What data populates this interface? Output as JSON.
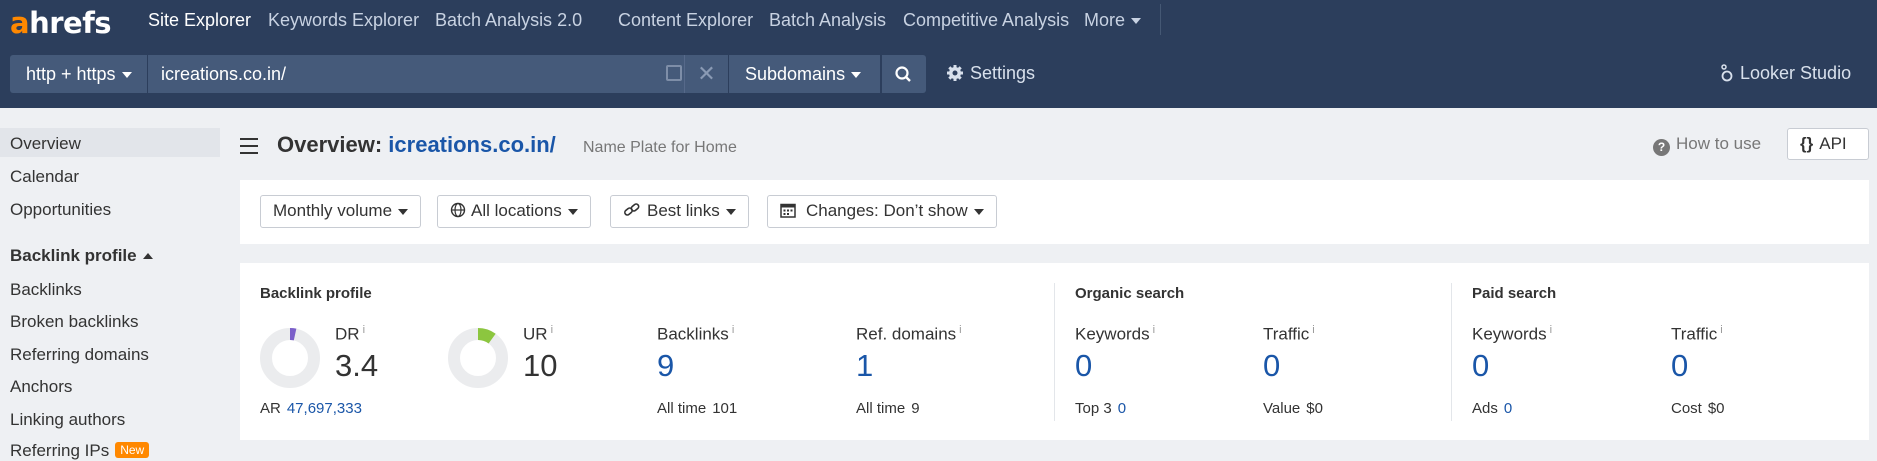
{
  "nav": {
    "logo_a": "a",
    "logo_rest": "hrefs",
    "items": [
      "Site Explorer",
      "Keywords Explorer",
      "Batch Analysis 2.0",
      "Content Explorer",
      "Batch Analysis",
      "Competitive Analysis",
      "More"
    ]
  },
  "search": {
    "protocol": "http + https",
    "url": "icreations.co.in/",
    "mode": "Subdomains",
    "settings_label": "Settings",
    "looker_label": "Looker Studio"
  },
  "sidebar": {
    "items": [
      "Overview",
      "Calendar",
      "Opportunities"
    ],
    "section": "Backlink profile",
    "sub_items": [
      "Backlinks",
      "Broken backlinks",
      "Referring domains",
      "Anchors",
      "Linking authors",
      "Referring IPs"
    ],
    "new_badge": "New"
  },
  "header": {
    "title_prefix": "Overview:",
    "title_link": "icreations.co.in/",
    "subtitle": "Name Plate for Home",
    "how_to": "How to use",
    "api": "API"
  },
  "filters": [
    "Monthly volume",
    "All locations",
    "Best links",
    "Changes: Don’t show"
  ],
  "metrics": {
    "backlink_profile": {
      "heading": "Backlink profile",
      "dr_label": "DR",
      "dr_value": "3.4",
      "dr_fraction": 0.034,
      "ar_label": "AR",
      "ar_value": "47,697,333",
      "ur_label": "UR",
      "ur_value": "10",
      "ur_fraction": 0.1,
      "backlinks_label": "Backlinks",
      "backlinks_value": "9",
      "backlinks_sub_label": "All time",
      "backlinks_sub_value": "101",
      "refdomains_label": "Ref. domains",
      "refdomains_value": "1",
      "refdomains_sub_label": "All time",
      "refdomains_sub_value": "9"
    },
    "organic": {
      "heading": "Organic search",
      "keywords_label": "Keywords",
      "keywords_value": "0",
      "keywords_sub_label": "Top 3",
      "keywords_sub_value": "0",
      "traffic_label": "Traffic",
      "traffic_value": "0",
      "traffic_sub_label": "Value",
      "traffic_sub_value": "$0"
    },
    "paid": {
      "heading": "Paid search",
      "keywords_label": "Keywords",
      "keywords_value": "0",
      "keywords_sub_label": "Ads",
      "keywords_sub_value": "0",
      "traffic_label": "Traffic",
      "traffic_value": "0",
      "traffic_sub_label": "Cost",
      "traffic_sub_value": "$0"
    },
    "info_mark": "i"
  },
  "colors": {
    "dr_arc": "#7b5fc9",
    "ur_arc": "#8cc63f",
    "accent": "#ff8800",
    "link": "#1a56a8"
  }
}
